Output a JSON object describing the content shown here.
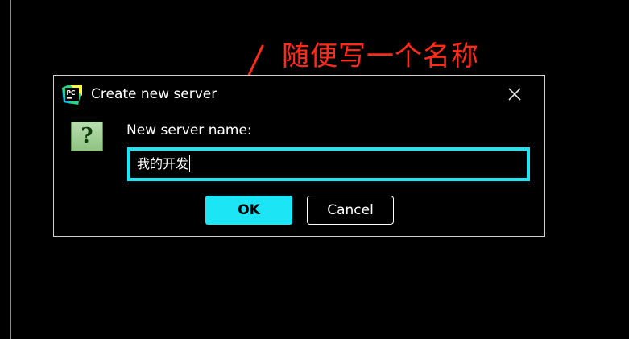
{
  "annotation": {
    "text": "随便写一个名称",
    "color": "#ff2a1a"
  },
  "dialog": {
    "title": "Create new server",
    "app_icon": "pycharm-icon",
    "app_icon_text": "PC",
    "close_icon": "close-icon",
    "question_icon": "question-icon",
    "question_glyph": "?",
    "field_label": "New server name:",
    "input_value": "我的开发",
    "ok_label": "OK",
    "cancel_label": "Cancel",
    "accent_color": "#1ce5f5"
  }
}
